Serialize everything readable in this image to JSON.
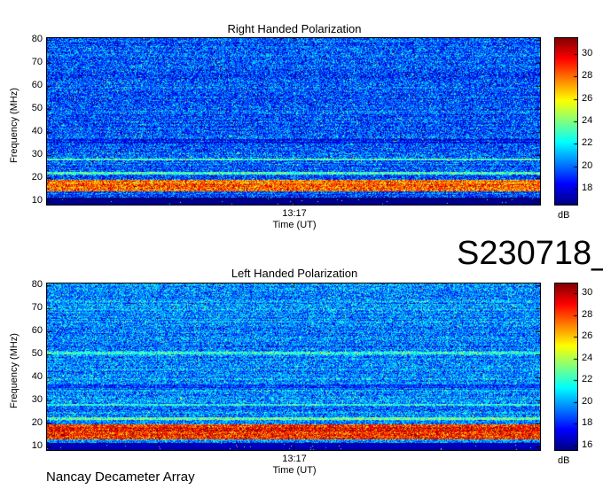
{
  "observation_id": "S230718_",
  "footer": "Nancay Decameter Array",
  "colors": {
    "colormap": [
      "#00007f",
      "#0000ff",
      "#0080ff",
      "#00ffff",
      "#80ff80",
      "#ffff00",
      "#ff8000",
      "#ff0000",
      "#7f0000"
    ]
  },
  "chart_data": [
    {
      "type": "heatmap",
      "title": "Right Handed Polarization",
      "xlabel": "Time (UT)",
      "ylabel": "Frequency (MHz)",
      "x_tick_labels": [
        "13:17"
      ],
      "y_ticks": [
        10,
        20,
        30,
        40,
        50,
        60,
        70,
        80
      ],
      "ylim": [
        8,
        81
      ],
      "colorbar": {
        "label": "dB",
        "range": [
          16.5,
          31.5
        ],
        "ticks": [
          18,
          20,
          22,
          24,
          26,
          28,
          30
        ]
      },
      "background_dB": 19.5,
      "features": [
        {
          "frequency_MHz": [
            8,
            11.5
          ],
          "level_dB": 16.5
        },
        {
          "frequency_MHz": [
            14,
            19
          ],
          "level_dB": 28
        },
        {
          "frequency_MHz": [
            21.5,
            22.5
          ],
          "level_dB": 23
        },
        {
          "frequency_MHz": [
            27.5,
            28.5
          ],
          "level_dB": 23
        },
        {
          "frequency_MHz": [
            35,
            37
          ],
          "level_dB": 18.5
        }
      ]
    },
    {
      "type": "heatmap",
      "title": "Left Handed Polarization",
      "xlabel": "Time (UT)",
      "ylabel": "Frequency (MHz)",
      "x_tick_labels": [
        "13:17"
      ],
      "y_ticks": [
        10,
        20,
        30,
        40,
        50,
        60,
        70,
        80
      ],
      "ylim": [
        8,
        81
      ],
      "colorbar": {
        "label": "dB",
        "range": [
          15.5,
          31
        ],
        "ticks": [
          16,
          18,
          20,
          22,
          24,
          26,
          28,
          30
        ]
      },
      "background_dB": 19.5,
      "features": [
        {
          "frequency_MHz": [
            8,
            11.5
          ],
          "level_dB": 16
        },
        {
          "frequency_MHz": [
            13,
            19.5
          ],
          "level_dB": 28.5
        },
        {
          "frequency_MHz": [
            21.5,
            22.5
          ],
          "level_dB": 23
        },
        {
          "frequency_MHz": [
            27.5,
            28.5
          ],
          "level_dB": 22
        },
        {
          "frequency_MHz": [
            35,
            37
          ],
          "level_dB": 18.5
        },
        {
          "frequency_MHz": [
            50,
            51
          ],
          "level_dB": 22
        }
      ]
    }
  ]
}
